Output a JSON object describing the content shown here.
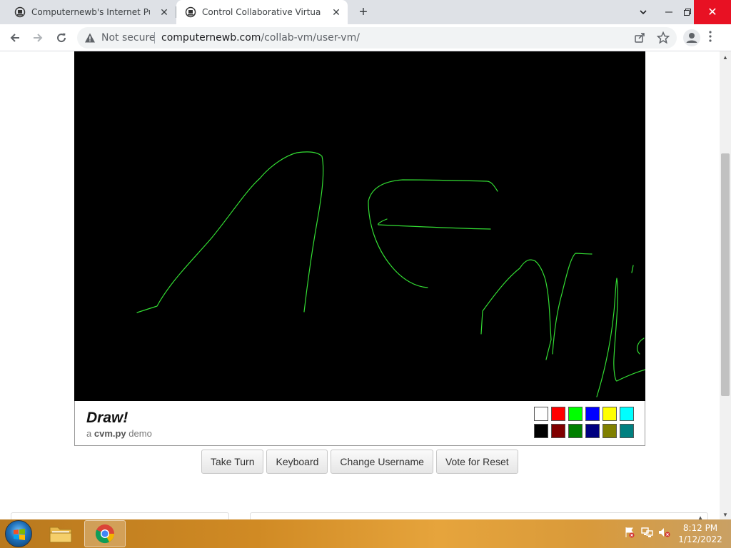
{
  "browser": {
    "tabs": [
      {
        "title": "Computernewb's Internet Pub Hub",
        "active": false
      },
      {
        "title": "Control Collaborative Virtual Machine",
        "active": true
      }
    ],
    "security_label": "Not secure",
    "url_host": "computernewb.com",
    "url_path": "/collab-vm/user-vm/"
  },
  "page": {
    "draw_title": "Draw!",
    "subtitle_prefix": "a",
    "subtitle_brand": "cvm.py",
    "subtitle_suffix": "demo",
    "palette": {
      "row1": [
        "#ffffff",
        "#ff0000",
        "#00ff00",
        "#0000ff",
        "#ffff00",
        "#00ffff"
      ],
      "row2": [
        "#000000",
        "#800000",
        "#008000",
        "#000080",
        "#808000",
        "#008080"
      ]
    },
    "buttons": {
      "take_turn": "Take Turn",
      "keyboard": "Keyboard",
      "change_username": "Change Username",
      "vote_reset": "Vote for Reset"
    },
    "stroke_color": "#33dd33"
  },
  "taskbar": {
    "time": "8:12 PM",
    "date": "1/12/2022"
  }
}
